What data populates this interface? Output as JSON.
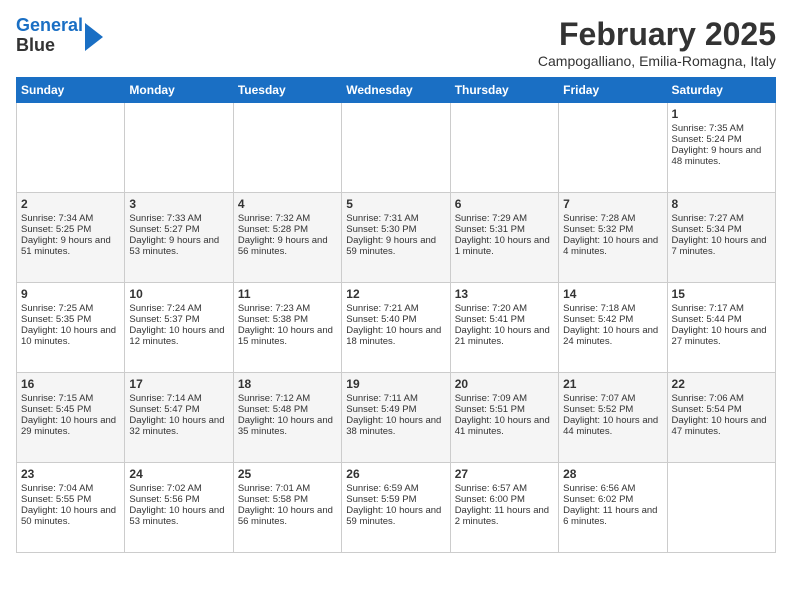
{
  "logo": {
    "line1": "General",
    "line2": "Blue"
  },
  "title": "February 2025",
  "subtitle": "Campogalliano, Emilia-Romagna, Italy",
  "days_of_week": [
    "Sunday",
    "Monday",
    "Tuesday",
    "Wednesday",
    "Thursday",
    "Friday",
    "Saturday"
  ],
  "weeks": [
    [
      {
        "day": "",
        "content": ""
      },
      {
        "day": "",
        "content": ""
      },
      {
        "day": "",
        "content": ""
      },
      {
        "day": "",
        "content": ""
      },
      {
        "day": "",
        "content": ""
      },
      {
        "day": "",
        "content": ""
      },
      {
        "day": "1",
        "content": "Sunrise: 7:35 AM\nSunset: 5:24 PM\nDaylight: 9 hours and 48 minutes."
      }
    ],
    [
      {
        "day": "2",
        "content": "Sunrise: 7:34 AM\nSunset: 5:25 PM\nDaylight: 9 hours and 51 minutes."
      },
      {
        "day": "3",
        "content": "Sunrise: 7:33 AM\nSunset: 5:27 PM\nDaylight: 9 hours and 53 minutes."
      },
      {
        "day": "4",
        "content": "Sunrise: 7:32 AM\nSunset: 5:28 PM\nDaylight: 9 hours and 56 minutes."
      },
      {
        "day": "5",
        "content": "Sunrise: 7:31 AM\nSunset: 5:30 PM\nDaylight: 9 hours and 59 minutes."
      },
      {
        "day": "6",
        "content": "Sunrise: 7:29 AM\nSunset: 5:31 PM\nDaylight: 10 hours and 1 minute."
      },
      {
        "day": "7",
        "content": "Sunrise: 7:28 AM\nSunset: 5:32 PM\nDaylight: 10 hours and 4 minutes."
      },
      {
        "day": "8",
        "content": "Sunrise: 7:27 AM\nSunset: 5:34 PM\nDaylight: 10 hours and 7 minutes."
      }
    ],
    [
      {
        "day": "9",
        "content": "Sunrise: 7:25 AM\nSunset: 5:35 PM\nDaylight: 10 hours and 10 minutes."
      },
      {
        "day": "10",
        "content": "Sunrise: 7:24 AM\nSunset: 5:37 PM\nDaylight: 10 hours and 12 minutes."
      },
      {
        "day": "11",
        "content": "Sunrise: 7:23 AM\nSunset: 5:38 PM\nDaylight: 10 hours and 15 minutes."
      },
      {
        "day": "12",
        "content": "Sunrise: 7:21 AM\nSunset: 5:40 PM\nDaylight: 10 hours and 18 minutes."
      },
      {
        "day": "13",
        "content": "Sunrise: 7:20 AM\nSunset: 5:41 PM\nDaylight: 10 hours and 21 minutes."
      },
      {
        "day": "14",
        "content": "Sunrise: 7:18 AM\nSunset: 5:42 PM\nDaylight: 10 hours and 24 minutes."
      },
      {
        "day": "15",
        "content": "Sunrise: 7:17 AM\nSunset: 5:44 PM\nDaylight: 10 hours and 27 minutes."
      }
    ],
    [
      {
        "day": "16",
        "content": "Sunrise: 7:15 AM\nSunset: 5:45 PM\nDaylight: 10 hours and 29 minutes."
      },
      {
        "day": "17",
        "content": "Sunrise: 7:14 AM\nSunset: 5:47 PM\nDaylight: 10 hours and 32 minutes."
      },
      {
        "day": "18",
        "content": "Sunrise: 7:12 AM\nSunset: 5:48 PM\nDaylight: 10 hours and 35 minutes."
      },
      {
        "day": "19",
        "content": "Sunrise: 7:11 AM\nSunset: 5:49 PM\nDaylight: 10 hours and 38 minutes."
      },
      {
        "day": "20",
        "content": "Sunrise: 7:09 AM\nSunset: 5:51 PM\nDaylight: 10 hours and 41 minutes."
      },
      {
        "day": "21",
        "content": "Sunrise: 7:07 AM\nSunset: 5:52 PM\nDaylight: 10 hours and 44 minutes."
      },
      {
        "day": "22",
        "content": "Sunrise: 7:06 AM\nSunset: 5:54 PM\nDaylight: 10 hours and 47 minutes."
      }
    ],
    [
      {
        "day": "23",
        "content": "Sunrise: 7:04 AM\nSunset: 5:55 PM\nDaylight: 10 hours and 50 minutes."
      },
      {
        "day": "24",
        "content": "Sunrise: 7:02 AM\nSunset: 5:56 PM\nDaylight: 10 hours and 53 minutes."
      },
      {
        "day": "25",
        "content": "Sunrise: 7:01 AM\nSunset: 5:58 PM\nDaylight: 10 hours and 56 minutes."
      },
      {
        "day": "26",
        "content": "Sunrise: 6:59 AM\nSunset: 5:59 PM\nDaylight: 10 hours and 59 minutes."
      },
      {
        "day": "27",
        "content": "Sunrise: 6:57 AM\nSunset: 6:00 PM\nDaylight: 11 hours and 2 minutes."
      },
      {
        "day": "28",
        "content": "Sunrise: 6:56 AM\nSunset: 6:02 PM\nDaylight: 11 hours and 6 minutes."
      },
      {
        "day": "",
        "content": ""
      }
    ]
  ]
}
